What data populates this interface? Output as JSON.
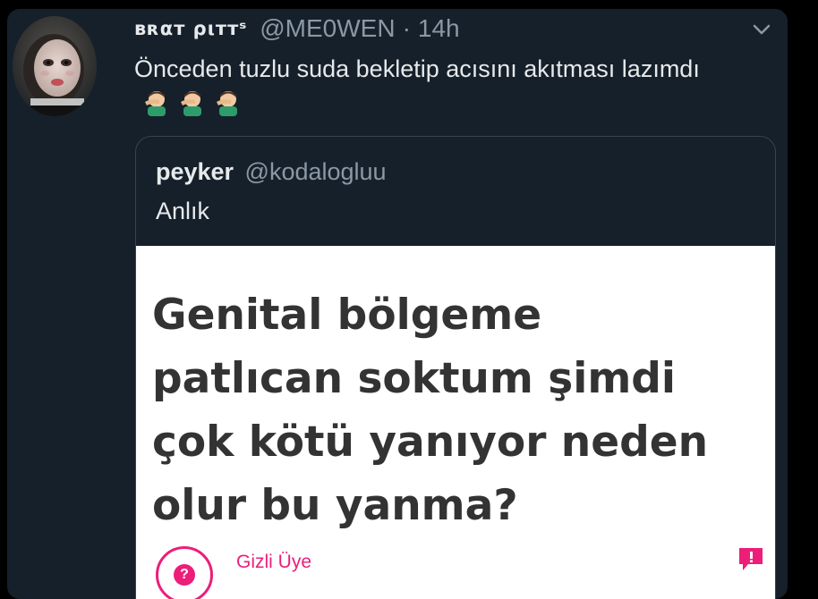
{
  "tweet": {
    "display_name": "ʙʀαт ριттˢ",
    "handle": "@ME0WEN",
    "separator": "·",
    "time": "14h",
    "text": "Önceden tuzlu suda bekletip acısını akıtması lazımdı",
    "emojis": [
      "face-palm-emoji",
      "face-palm-emoji",
      "face-palm-emoji"
    ],
    "menu_icon": "chevron-down-icon"
  },
  "quoted_tweet": {
    "name": "peyker",
    "handle": "@kodalogluu",
    "text": "Anlık",
    "image": {
      "question": "Genital bölgeme patlıcan soktum şimdi çok kötü yanıyor neden olur bu yanma?",
      "author_label": "Gizli Üye",
      "avatar_glyph": "?",
      "accent_color": "#ec1e79"
    }
  },
  "colors": {
    "background": "#000000",
    "card": "#15202b",
    "text_primary": "#e7e9ea",
    "text_secondary": "#8b98a5",
    "border": "#38444d"
  }
}
